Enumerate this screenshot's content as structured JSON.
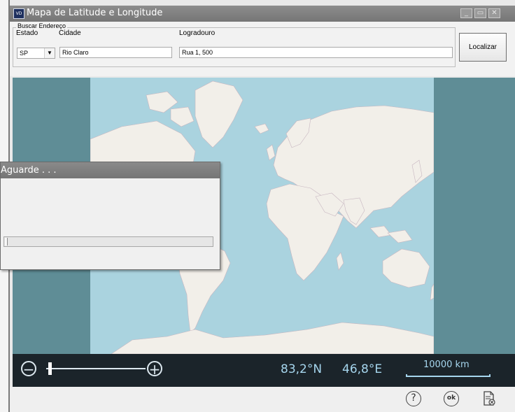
{
  "window": {
    "title": "Mapa de Latitude e Longitude",
    "app_icon_text": "VD"
  },
  "search": {
    "group_label": "Buscar Endereço",
    "estado_label": "Estado",
    "estado_value": "SP",
    "cidade_label": "Cidade",
    "cidade_value": "Rio Claro",
    "logradouro_label": "Logradouro",
    "logradouro_value": "Rua 1, 500",
    "locate_button": "Localizar"
  },
  "map": {
    "latitude": "83,2°N",
    "longitude": "46,8°E",
    "scale_label": "10000 km",
    "zoom_level": 0.02
  },
  "dialog": {
    "title": "Aguarde . . .",
    "progress": 0.01
  },
  "footer": {
    "help_icon": "help-icon",
    "ok_icon": "ok-icon",
    "doc_icon": "document-close-icon"
  },
  "colors": {
    "ocean": "#aad3df",
    "land": "#f2efe9",
    "map_outside": "#5f8d96",
    "toolbar": "#1b242a",
    "toolbar_text": "#a6d6ee"
  }
}
